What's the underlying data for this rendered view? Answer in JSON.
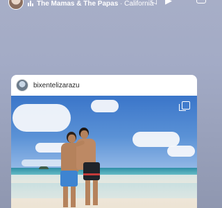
{
  "story": {
    "music": {
      "artist": "The Mamas & The Papas",
      "separator": "·",
      "location": "California"
    },
    "icons": [
      "music-icon",
      "volume-icon",
      "play-icon",
      "menu-icon"
    ]
  },
  "post_card": {
    "username": "bixentelizarazu",
    "icons": [
      "multiple-photos-icon"
    ]
  },
  "colors": {
    "background": "#a3abc6",
    "card_background": "#ffffff",
    "username_text": "#262626",
    "header_text": "#ffffff"
  }
}
